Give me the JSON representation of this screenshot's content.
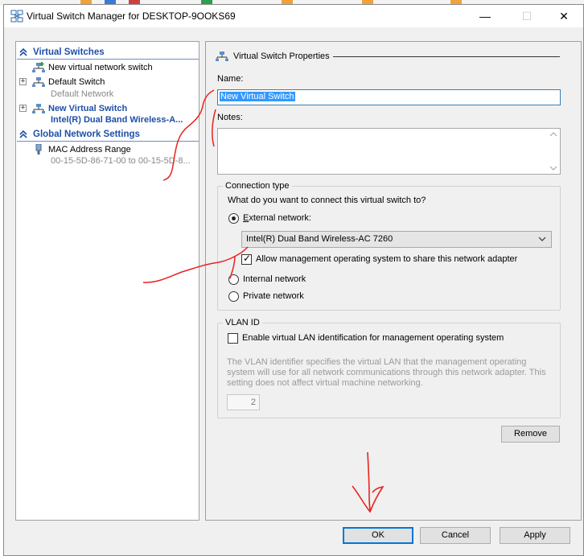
{
  "window": {
    "title": "Virtual Switch Manager for DESKTOP-9OOKS69",
    "controls": {
      "minimize": "—",
      "maximize": "☐",
      "close": "✕"
    }
  },
  "tree": {
    "virtual_switches_header": "Virtual Switches",
    "items": [
      {
        "label": "New virtual network switch",
        "sub": ""
      },
      {
        "label": "Default Switch",
        "sub": "Default Network"
      },
      {
        "label": "New Virtual Switch",
        "sub": "Intel(R) Dual Band Wireless-A..."
      }
    ],
    "global_header": "Global Network Settings",
    "global_items": [
      {
        "label": "MAC Address Range",
        "sub": "00-15-5D-86-71-00 to 00-15-5D-8..."
      }
    ]
  },
  "properties": {
    "section_title": "Virtual Switch Properties",
    "name_label": "Name:",
    "name_value": "New Virtual Switch",
    "notes_label": "Notes:",
    "notes_value": "",
    "connection": {
      "caption": "Connection type",
      "question": "What do you want to connect this virtual switch to?",
      "external_label": "External network:",
      "adapter_selected": "Intel(R) Dual Band Wireless-AC 7260",
      "allow_mgmt_label": "Allow management operating system to share this network adapter",
      "allow_mgmt_checked": true,
      "internal_label": "Internal network",
      "private_label": "Private network",
      "selected": "external"
    },
    "vlan": {
      "caption": "VLAN ID",
      "enable_label": "Enable virtual LAN identification for management operating system",
      "enabled": false,
      "description": "The VLAN identifier specifies the virtual LAN that the management operating system will use for all network communications through this network adapter. This setting does not affect virtual machine networking.",
      "id_value": "2"
    },
    "remove_button": "Remove"
  },
  "footer": {
    "ok": "OK",
    "cancel": "Cancel",
    "apply": "Apply"
  },
  "colors": {
    "header_blue": "#1f4fa8",
    "selection": "#3399ff",
    "annotation": "#e8231f"
  }
}
